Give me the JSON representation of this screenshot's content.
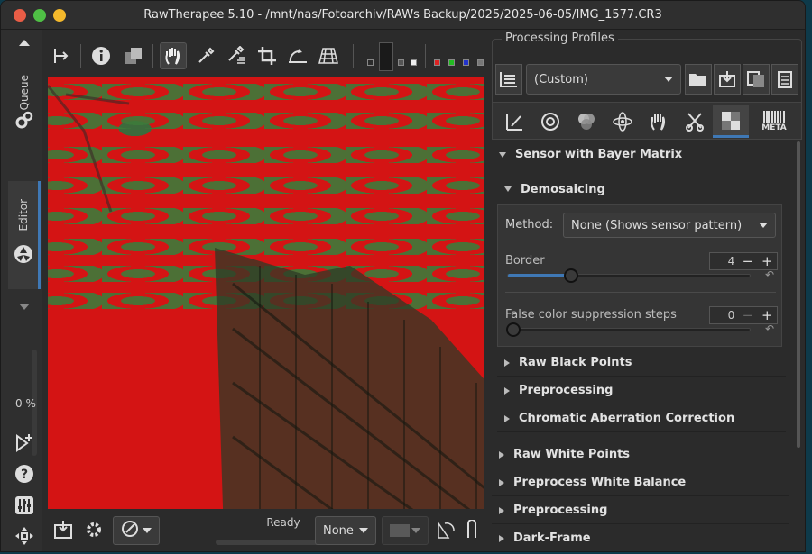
{
  "window": {
    "title": "RawTherapee 5.10 - /mnt/nas/Fotoarchiv/RAWs Backup/2025/2025-06-05/IMG_1577.CR3"
  },
  "left_strip": {
    "queue_label": "Queue",
    "editor_label": "Editor",
    "zoom_percent": "0 %"
  },
  "toolbar": {
    "icons": [
      "panel-toggle-icon",
      "info-icon",
      "before-after-icon",
      "hand-icon",
      "color-picker-icon",
      "white-balance-picker-icon",
      "crop-icon",
      "straighten-icon",
      "perspective-grid-icon"
    ]
  },
  "bottom": {
    "status": "Ready",
    "profile_select": "None"
  },
  "processing_profiles": {
    "title": "Processing Profiles",
    "selected": "(Custom)"
  },
  "tabs": {
    "meta_label": "META"
  },
  "panel": {
    "sensor_section": "Sensor with Bayer Matrix",
    "demosaicing": "Demosaicing",
    "method_label": "Method:",
    "method_value": "None (Shows sensor pattern)",
    "border_label": "Border",
    "border_value": "4",
    "false_color_label": "False color suppression steps",
    "false_color_value": "0",
    "subsections": [
      "Raw Black Points",
      "Preprocessing",
      "Chromatic Aberration Correction"
    ],
    "sections": [
      "Raw White Points",
      "Preprocess White Balance",
      "Preprocessing",
      "Dark-Frame"
    ]
  },
  "colors": {
    "accent": "#3f78b5",
    "viewer_red": "#d41414",
    "viewer_green": "#3d7a3a"
  }
}
